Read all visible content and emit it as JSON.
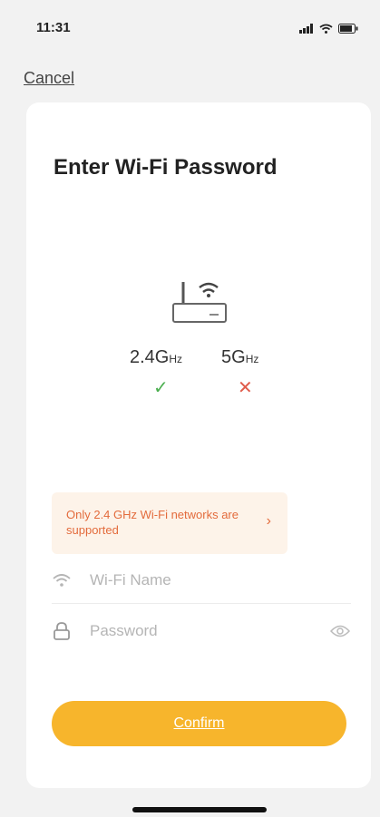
{
  "status_bar": {
    "time": "11:31"
  },
  "header": {
    "cancel_label": "Cancel"
  },
  "card": {
    "title": "Enter Wi-Fi Password",
    "bands": {
      "band_24": {
        "value": "2.4G",
        "unit": "Hz",
        "supported": true
      },
      "band_5": {
        "value": "5G",
        "unit": "Hz",
        "supported": false
      }
    },
    "notice": {
      "text": "Only 2.4 GHz Wi-Fi networks are supported",
      "arrow": "›"
    },
    "wifi_name": {
      "placeholder": "Wi-Fi Name",
      "value": ""
    },
    "password": {
      "placeholder": "Password",
      "value": ""
    },
    "confirm_label": "Confirm"
  },
  "icons": {
    "router": "router-icon",
    "wifi": "wifi-icon",
    "lock": "lock-icon",
    "eye": "eye-icon",
    "check": "check-icon",
    "cross": "cross-icon"
  },
  "colors": {
    "accent": "#f7b52c",
    "notice_text": "#e36b3c",
    "notice_bg": "#fdf3e9",
    "check": "#4caf50",
    "cross": "#e05c4b"
  }
}
